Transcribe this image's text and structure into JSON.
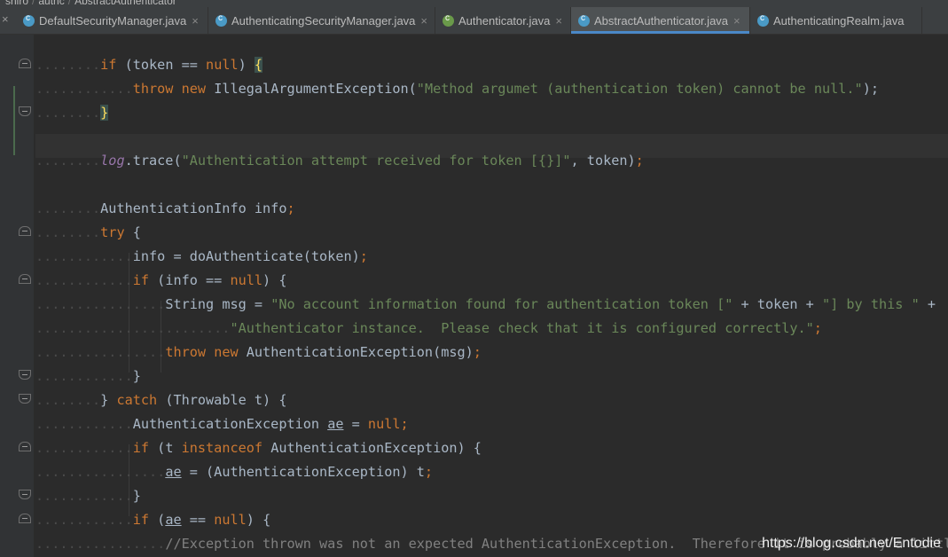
{
  "breadcrumb": [
    "shiro",
    "authc",
    "AbstractAuthenticator"
  ],
  "tabs": [
    {
      "label": "DefaultSecurityManager.java",
      "icon": "class-icon",
      "color": "#4a9ac6"
    },
    {
      "label": "AuthenticatingSecurityManager.java",
      "icon": "class-icon",
      "color": "#4a9ac6"
    },
    {
      "label": "Authenticator.java",
      "icon": "interface-icon",
      "color": "#6a9a4a"
    },
    {
      "label": "AbstractAuthenticator.java",
      "icon": "abstract-class-icon",
      "color": "#4a9ac6",
      "active": true
    },
    {
      "label": "AuthenticatingRealm.java",
      "icon": "abstract-class-icon",
      "color": "#4a9ac6"
    }
  ],
  "tab_close_glyph": "×",
  "code": {
    "l1": {
      "kw": "if",
      "rest": " (token == ",
      "null": "null",
      "tail": ") ",
      "brace": "{"
    },
    "l2": {
      "kw1": "throw",
      "kw2": "new",
      "cls": " IllegalArgumentException(",
      "str": "\"Method argumet (authentication token) cannot be null.\"",
      "tail": ");"
    },
    "l3": {
      "brace": "}"
    },
    "l4": {
      "field": "log",
      "call": ".trace(",
      "str": "\"Authentication attempt received for token [{}]\"",
      "tail": ", token)",
      "semi": ";"
    },
    "l5": {
      "text": "AuthenticationInfo info",
      "semi": ";"
    },
    "l6": {
      "kw": "try",
      "tail": " {"
    },
    "l7": {
      "text": "info = doAuthenticate(token)",
      "semi": ";"
    },
    "l8": {
      "kw": "if",
      "rest": " (info == ",
      "null": "null",
      "tail": ") {"
    },
    "l9": {
      "pre": "String msg = ",
      "str1": "\"No account information found for authentication token [\"",
      "mid": " + token + ",
      "str2": "\"] by this \"",
      "tail": " +"
    },
    "l10": {
      "str": "\"Authenticator instance.  Please check that it is configured correctly.\"",
      "semi": ";"
    },
    "l11": {
      "kw1": "throw",
      "kw2": "new",
      "cls": " AuthenticationException(msg)",
      "semi": ";"
    },
    "l12": {
      "text": "}"
    },
    "l13": {
      "pre": "} ",
      "kw": "catch",
      "tail": " (Throwable t) {"
    },
    "l14": {
      "pre": "AuthenticationException ",
      "var": "ae",
      "mid": " = ",
      "null": "null",
      "semi": ";"
    },
    "l15": {
      "kw1": "if",
      "mid": " (t ",
      "kw2": "instanceof",
      "tail": " AuthenticationException) {"
    },
    "l16": {
      "var": "ae",
      "tail": " = (AuthenticationException) t",
      "semi": ";"
    },
    "l17": {
      "text": "}"
    },
    "l18": {
      "kw": "if",
      "pre": " (",
      "var": "ae",
      "mid": " == ",
      "null": "null",
      "tail": ") {"
    },
    "l19": {
      "comment": "//Exception thrown was not an expected AuthenticationException.  Therefore it is probably a little"
    }
  },
  "watermark": "https://blog.csdn.net/Entodie"
}
